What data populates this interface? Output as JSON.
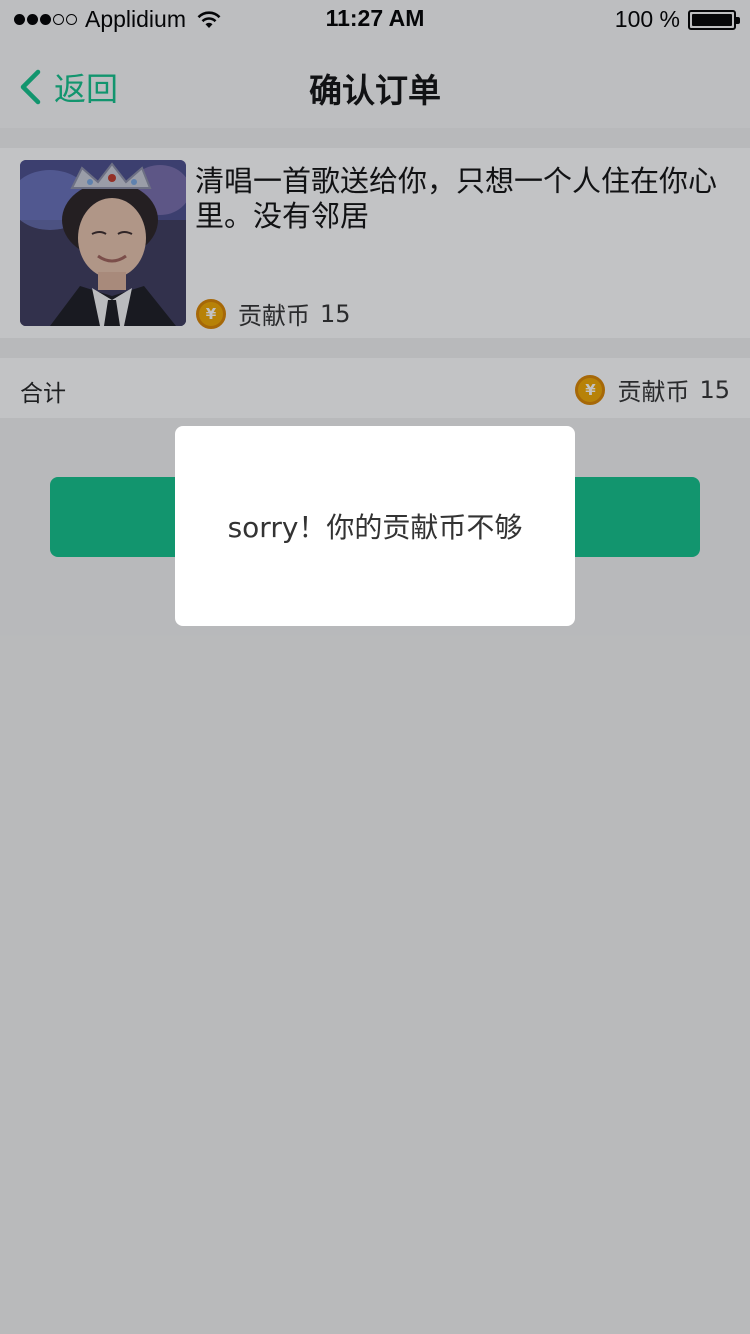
{
  "status_bar": {
    "carrier": "Applidium",
    "time": "11:27 AM",
    "battery": "100 %",
    "icons": [
      "signal-dots",
      "wifi-icon",
      "battery-icon"
    ]
  },
  "nav": {
    "back_label": "返回",
    "title": "确认订单"
  },
  "product": {
    "title": "清唱一首歌送给你，只想一个人住在你心里。没有邻居",
    "currency_label": "贡献币",
    "price": "15",
    "coin_symbol": "¥"
  },
  "total": {
    "label": "合计",
    "currency_label": "贡献币",
    "value": "15",
    "coin_symbol": "¥"
  },
  "alert": {
    "message": "sorry！你的贡献币不够"
  },
  "colors": {
    "accent": "#12c18a",
    "coin": "#f0a800"
  }
}
